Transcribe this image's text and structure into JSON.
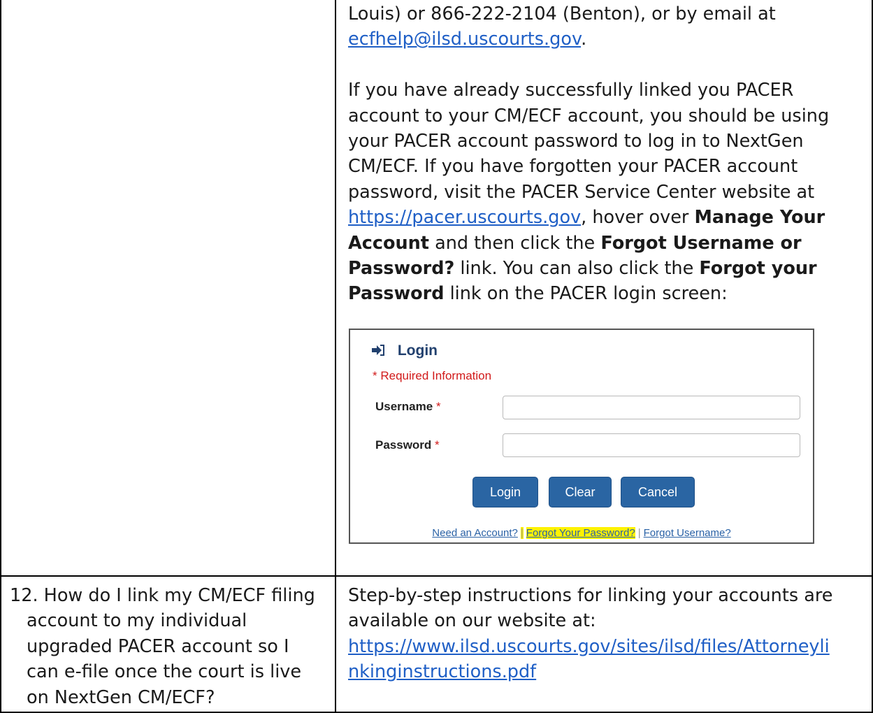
{
  "top_cell": {
    "intro_prefix": "Louis) or 866-222-2104 (Benton), or by email at",
    "email_link": "ecfhelp@ilsd.uscourts.gov",
    "email_suffix": ".",
    "para_lines": [
      "If you have already successfully linked you PACER",
      "account to your CM/ECF account, you should be using",
      "your PACER account password to log in to NextGen",
      "CM/ECF.  If you have forgotten your PACER account",
      "password, visit the PACER Service Center website at"
    ],
    "pacer_link": "https://pacer.uscourts.gov",
    "pacer_suffix": ", hover over ",
    "bold_manage": "Manage Your",
    "bold_account": "Account",
    "then_click": " and then click the ",
    "bold_forgot_user": "Forgot Username or",
    "bold_password_q": "Password?",
    "link_text_tail": " link.  You can also click the ",
    "bold_forgot_your": "Forgot your",
    "bold_password": "Password",
    "login_screen_tail": " link on the PACER login screen:"
  },
  "login_screenshot": {
    "title": "Login",
    "required": "* Required Information",
    "username_label": "Username",
    "password_label": "Password",
    "star": "*",
    "btn_login": "Login",
    "btn_clear": "Clear",
    "btn_cancel": "Cancel",
    "link_need_account": "Need an Account?",
    "link_forgot_password": "Forgot Your Password?",
    "link_forgot_username": "Forgot Username?",
    "separator": "|"
  },
  "row12": {
    "question_lines": [
      "12. How do I link my CM/ECF filing",
      "account to my individual",
      "upgraded PACER account so I",
      "can e-file once the court is live",
      "on NextGen CM/ECF?"
    ],
    "answer_lines": [
      "Step-by-step instructions for linking your accounts are",
      "available on our website at:"
    ],
    "link_lines": [
      "https://www.ilsd.uscourts.gov/sites/ilsd/files/Attorneyli",
      "nkinginstructions.pdf"
    ]
  },
  "colors": {
    "link": "#1f5fc6",
    "button": "#2a65a3",
    "highlight": "#fff200",
    "required": "#d11a1a",
    "login_title": "#21406e"
  }
}
